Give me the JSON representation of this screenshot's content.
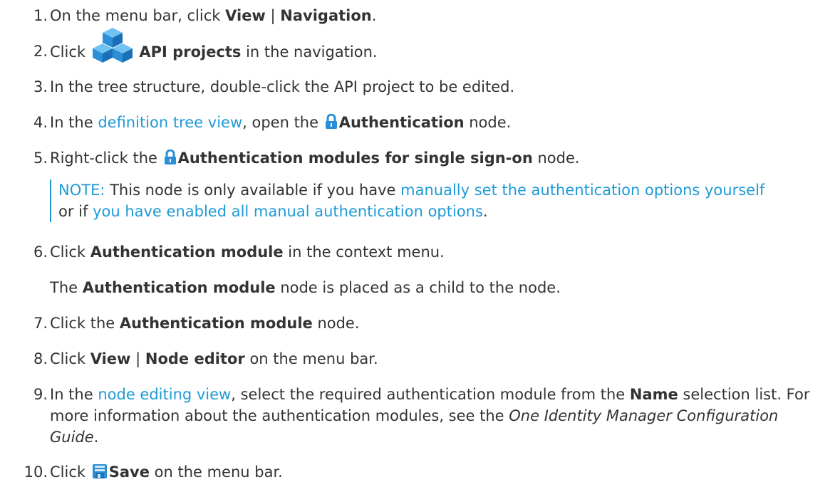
{
  "steps": [
    {
      "num": "1.",
      "a": "On the menu bar, click ",
      "b1": "View",
      "sep": " | ",
      "b2": "Navigation",
      "end": "."
    },
    {
      "num": "2.",
      "a": "Click ",
      "b1": "API projects",
      "end": " in the navigation."
    },
    {
      "num": "3.",
      "a": "In the tree structure, double-click the API project to be edited."
    },
    {
      "num": "4.",
      "a": "In the ",
      "link": "definition tree view",
      "mid": ", open the ",
      "b1": "Authentication",
      "end": " node."
    },
    {
      "num": "5.",
      "a": "Right-click the ",
      "b1": "Authentication modules for single sign-on",
      "end": " node."
    },
    {
      "num": "6.",
      "a": "Click ",
      "b1": "Authentication module",
      "end": " in the context menu."
    },
    {
      "num": "7.",
      "a": "Click the ",
      "b1": "Authentication module",
      "end": " node."
    },
    {
      "num": "8.",
      "a": "Click ",
      "b1": "View",
      "sep": " | ",
      "b2": "Node editor",
      "end": " on the menu bar."
    },
    {
      "num": "9.",
      "a": "In the ",
      "link": "node editing view",
      "mid": ", select the required authentication module from the ",
      "b1": "Name",
      "end": " selection list. For more information about the authentication modules, see the ",
      "italic": "One Identity Manager Configuration Guide",
      "end2": "."
    },
    {
      "num": "10.",
      "a": "Click ",
      "b1": "Save",
      "end": " on the menu bar."
    }
  ],
  "note": {
    "label": "NOTE:",
    "t1": " This node is only available if you have ",
    "link1": "manually set the authentication options yourself",
    "t2": " or if ",
    "link2": "you have enabled all manual authentication options",
    "t3": "."
  },
  "step6_sub": {
    "a": "The ",
    "b1": "Authentication module",
    "end": " node is placed as a child to the node."
  },
  "icons": {
    "api_projects": "cubes-icon",
    "authentication": "lock-icon",
    "save": "save-icon"
  },
  "colors": {
    "link": "#1e9ad6",
    "text": "#333333",
    "icon_blue": "#2a8fd6"
  }
}
